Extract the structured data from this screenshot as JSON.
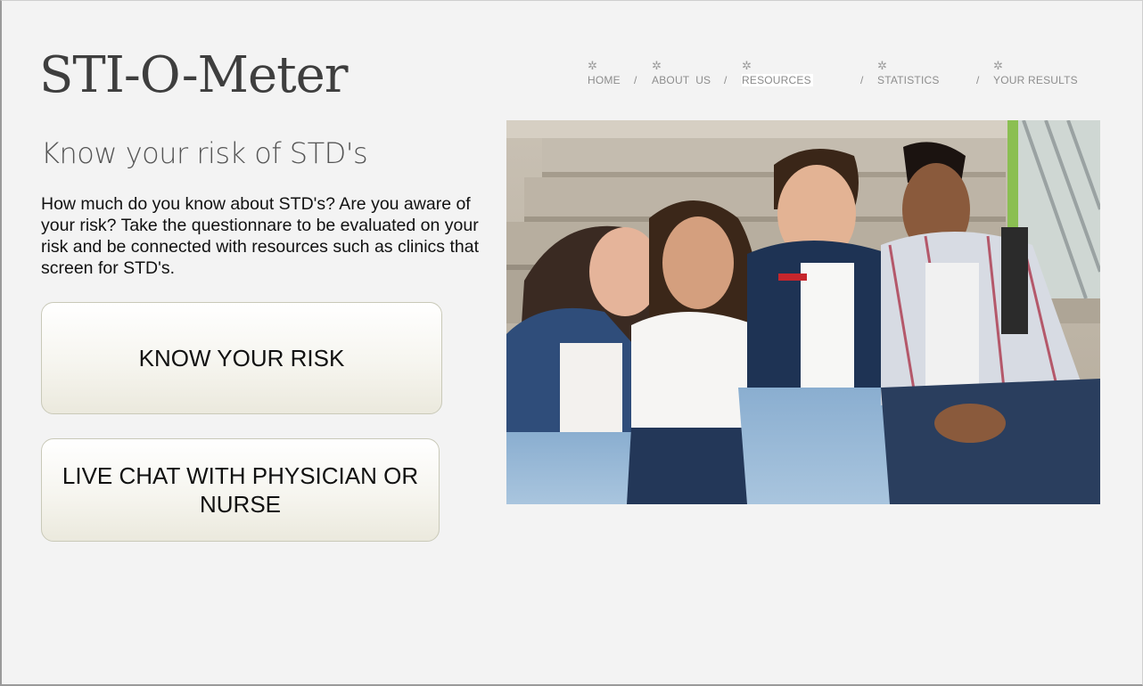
{
  "site": {
    "brand": "STI-O-Meter"
  },
  "nav": {
    "items": [
      {
        "label": "HOME",
        "icon": "gear-icon"
      },
      {
        "label": "ABOUT  US",
        "icon": "gear-icon"
      },
      {
        "label": "RESOURCES",
        "icon": "gear-icon",
        "active": true
      },
      {
        "label": "STATISTICS",
        "icon": "gear-icon"
      },
      {
        "label": "YOUR RESULTS",
        "icon": "gear-icon"
      }
    ],
    "separator": "/"
  },
  "hero": {
    "tagline": "Know your risk of STD's",
    "intro": "How much do you know about STD's? Are you aware of your risk? Take the questionnare to be evaluated on your risk and be connected with resources such as clinics that screen for STD's."
  },
  "actions": {
    "know_risk_label": "KNOW YOUR RISK",
    "live_chat_label": "LIVE CHAT WITH PHYSICIAN OR NURSE"
  },
  "colors": {
    "background": "#f3f3f3",
    "brand_text": "#3e3e3e",
    "nav_text": "#8d8d8d",
    "button_border": "#c9c9b8"
  }
}
